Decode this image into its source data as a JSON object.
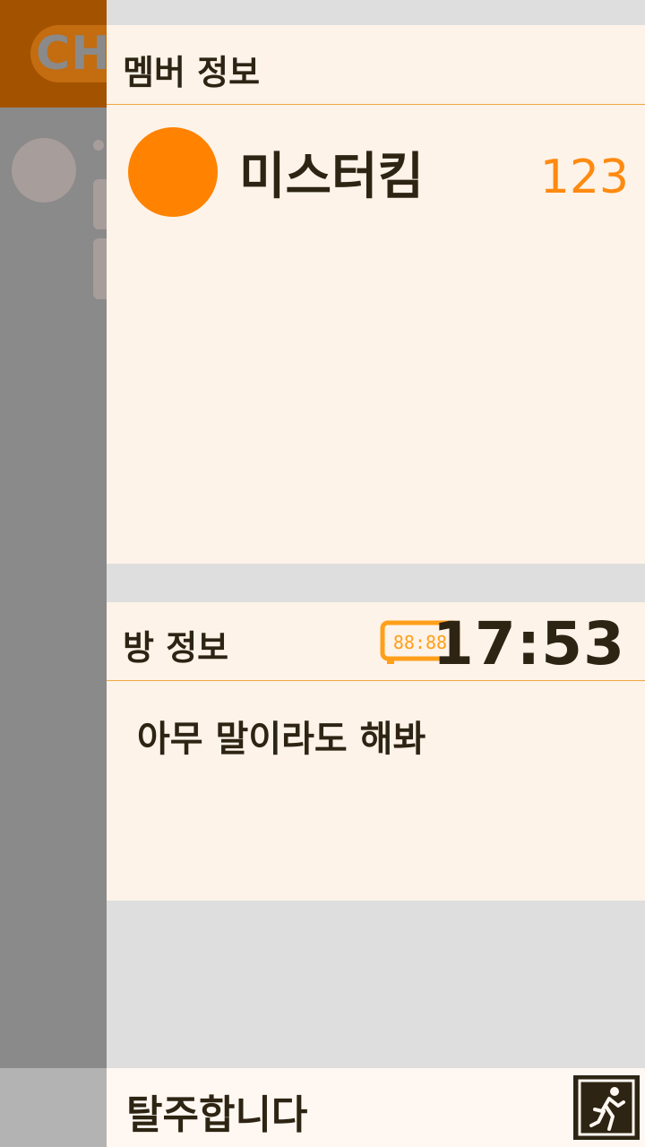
{
  "background": {
    "logo_text": "CH"
  },
  "member_info": {
    "title": "멤버 정보",
    "members": [
      {
        "name": "미스터킴",
        "score": "123",
        "avatar_color": "#ff8200"
      }
    ]
  },
  "room_info": {
    "title": "방 정보",
    "clock_icon": "digital-clock-icon",
    "clock_icon_text": "88:88",
    "time": "17:53",
    "message": "아무 말이라도 해봐"
  },
  "leave": {
    "label": "탈주합니다",
    "icon": "emergency-exit-icon"
  },
  "colors": {
    "accent": "#ff8200",
    "panel_bg": "#fdf3e9",
    "text": "#2d2413",
    "divider": "#f0a842"
  }
}
